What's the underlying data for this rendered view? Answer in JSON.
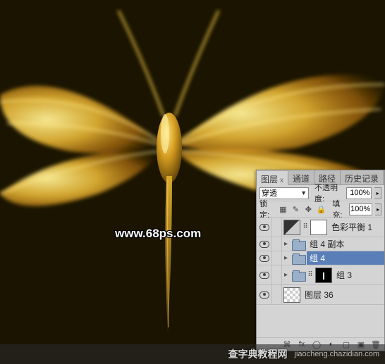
{
  "canvas": {
    "watermark_url": "www.68ps.com",
    "footer_site_cn": "查字典教程网",
    "footer_site_en": "jiaocheng.chazidian.com"
  },
  "panel": {
    "tabs": {
      "layers": "图层",
      "channels": "通道",
      "paths": "路径",
      "history": "历史记录"
    },
    "close_x": "x",
    "blend_mode": "穿透",
    "opacity_label": "不透明度:",
    "opacity_value": "100%",
    "lock_label": "锁定:",
    "fill_label": "填充:",
    "fill_value": "100%",
    "layers": [
      {
        "name": "色彩平衡 1"
      },
      {
        "name": "组 4 副本"
      },
      {
        "name": "组 4"
      },
      {
        "name": "组 3"
      },
      {
        "name": "图层 36"
      }
    ],
    "footer_icons": {
      "link": "⌘",
      "fx": "fx",
      "mask": "◯",
      "adjust": "◐",
      "folder": "▢",
      "new": "▣",
      "trash": "🗑"
    }
  }
}
